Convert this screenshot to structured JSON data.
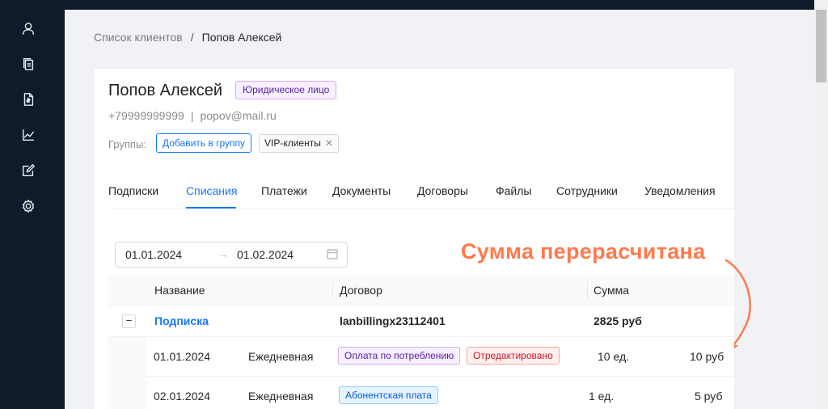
{
  "sidebar": {
    "items": [
      {
        "icon": "user-icon"
      },
      {
        "icon": "copy-documents-icon"
      },
      {
        "icon": "invoice-document-icon"
      },
      {
        "icon": "line-chart-icon"
      },
      {
        "icon": "edit-square-icon"
      },
      {
        "icon": "settings-gear-icon"
      }
    ]
  },
  "breadcrumb": {
    "parent": "Список клиентов",
    "separator": "/",
    "current": "Попов Алексей"
  },
  "client": {
    "name": "Попов Алексей",
    "type_badge": "Юридическое лицо",
    "phone": "+79999999999",
    "contact_separator": "|",
    "email": "popov@mail.ru",
    "groups_label": "Группы:",
    "add_group_button": "Добавить в группу",
    "groups": [
      "VIP-клиенты"
    ]
  },
  "tabs": {
    "items": [
      "Подписки",
      "Списания",
      "Платежи",
      "Документы",
      "Договоры",
      "Файлы",
      "Сотрудники",
      "Уведомления"
    ],
    "active": "Списания"
  },
  "date_range": {
    "from": "01.01.2024",
    "arrow": "→",
    "to": "01.02.2024"
  },
  "annotation": {
    "text": "Сумма перерасчитана"
  },
  "table": {
    "headers": {
      "name": "Название",
      "contract": "Договор",
      "sum": "Сумма"
    },
    "group": {
      "expand_symbol": "−",
      "name": "Подписка",
      "contract": "lanbillingx23112401",
      "sum": "2825 руб"
    },
    "rows": [
      {
        "date": "01.01.2024",
        "period": "Ежедневная",
        "tags": [
          "Оплата по потреблению",
          "Отредактировано"
        ],
        "qty": "10 ед.",
        "amount": "10 руб"
      },
      {
        "date": "02.01.2024",
        "period": "Ежедневная",
        "tags": [
          "Абонентская плата"
        ],
        "qty": "1 ед.",
        "amount": "5 руб"
      }
    ]
  },
  "colors": {
    "sidebar_bg": "#0f1a2a",
    "accent": "#1677ff",
    "annotation": "#ff7a4d"
  }
}
